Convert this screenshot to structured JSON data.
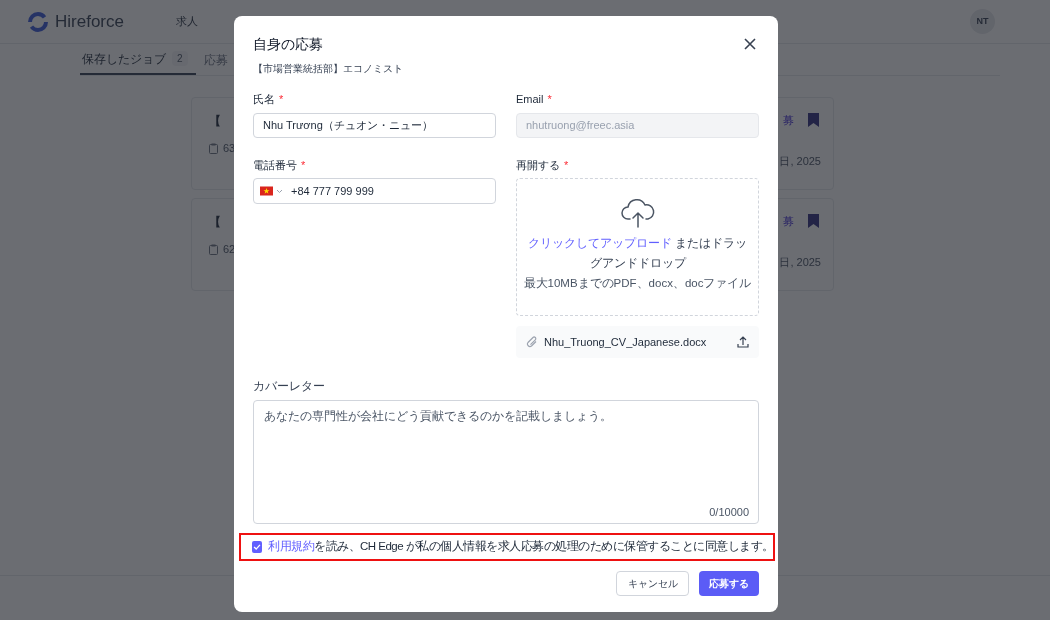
{
  "header": {
    "logo": "Hireforce",
    "nav": [
      {
        "label": "求人",
        "selected": false
      }
    ],
    "avatar": "NT"
  },
  "tabs": [
    {
      "label": "保存したジョブ",
      "count": "2",
      "selected": true
    },
    {
      "label": "応募",
      "selected": false
    }
  ],
  "cards": [
    {
      "title": "【",
      "meta": "63",
      "action": "募",
      "date": "日, 2025",
      "bookmarked": true
    },
    {
      "title": "【",
      "meta": "62",
      "action": "募",
      "date": "日, 2025",
      "bookmarked": true
    }
  ],
  "dialog": {
    "title": "自身の応募",
    "subtitle": "【市場営業統括部】エコノミスト",
    "name": {
      "label": "氏名",
      "required_mark": "*",
      "value": "Nhu Trương（チュオン・ニュー）"
    },
    "email": {
      "label": "Email",
      "required_mark": "*",
      "value": "nhutruong@freec.asia",
      "disabled": true
    },
    "phone": {
      "label": "電話番号",
      "required_mark": "*",
      "value": "+84 777 799 999"
    },
    "resume": {
      "label": "再開する",
      "required_mark": "*",
      "upload_link": "クリックしてアップロード",
      "upload_text": "またはドラッグアンドドロップ",
      "hint": "最大10MBまでのPDF、docx、docファイル",
      "file": "Nhu_Truong_CV_Japanese.docx"
    },
    "cover_letter": {
      "label": "カバーレター",
      "placeholder": "あなたの専門性が会社にどう貢献できるのかを記載しましょう。",
      "counter": "0/10000"
    },
    "agreement": {
      "checked": true,
      "highlighted": true,
      "link": "利用規約",
      "text": "を読み、CH Edge が私の個人情報を求人応募の処理のために保管することに同意します。"
    },
    "buttons": [
      {
        "kind": "secondary",
        "label": "キャンセル"
      },
      {
        "kind": "primary",
        "label": "応募する"
      }
    ]
  }
}
